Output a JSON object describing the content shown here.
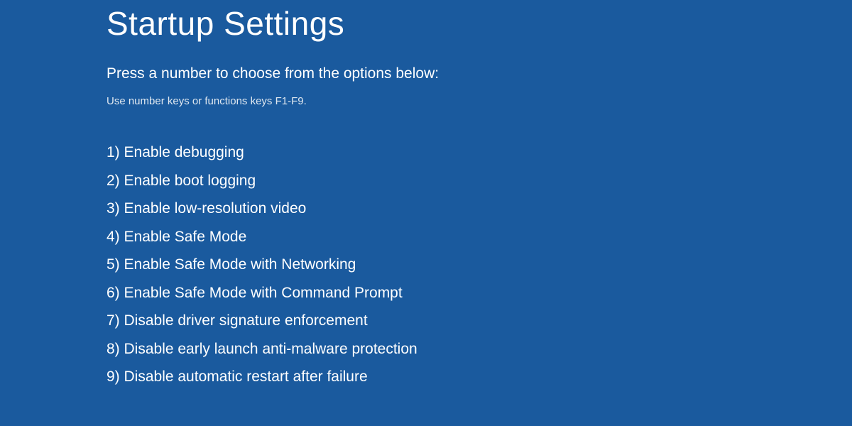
{
  "title": "Startup Settings",
  "instruction": "Press a number to choose from the options below:",
  "hint": "Use number keys or functions keys F1-F9.",
  "options": [
    "1) Enable debugging",
    "2) Enable boot logging",
    "3) Enable low-resolution video",
    "4) Enable Safe Mode",
    "5) Enable Safe Mode with Networking",
    "6) Enable Safe Mode with Command Prompt",
    "7) Disable driver signature enforcement",
    "8) Disable early launch anti-malware protection",
    "9) Disable automatic restart after failure"
  ],
  "colors": {
    "background": "#1a5a9e",
    "text": "#ffffff"
  }
}
